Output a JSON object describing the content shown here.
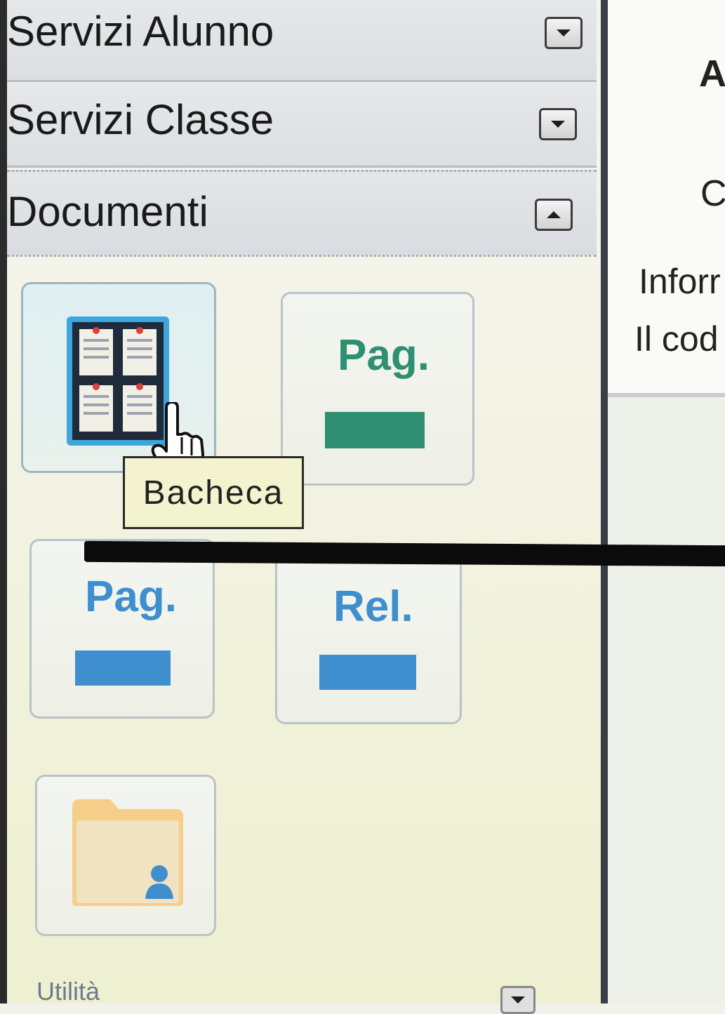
{
  "sidebar": {
    "sections": [
      {
        "title": "Servizi Alunno",
        "toggle": "expand"
      },
      {
        "title": "Servizi Classe",
        "toggle": "expand"
      },
      {
        "title": "Documenti",
        "toggle": "collapse"
      }
    ],
    "documenti_tiles": [
      {
        "icon": "bulletin-board-icon",
        "label": "",
        "state": "hover"
      },
      {
        "label": "Pag.",
        "color": "#2e8f73"
      },
      {
        "label": "Pag.",
        "color": "#3f8fcf"
      },
      {
        "label": "Rel.",
        "color": "#3f8fcf"
      },
      {
        "icon": "user-folder-icon",
        "label": ""
      }
    ],
    "tooltip": "Bacheca",
    "next_section": {
      "title": "Utilità",
      "toggle": "expand"
    }
  },
  "main": {
    "heading": "A",
    "line_c": "C",
    "line_info": "Inforr",
    "line_cod": "Il cod"
  },
  "colors": {
    "green_accent": "#2e8f73",
    "blue_accent": "#3f8fcf",
    "tooltip_bg": "#f4f3cf"
  }
}
